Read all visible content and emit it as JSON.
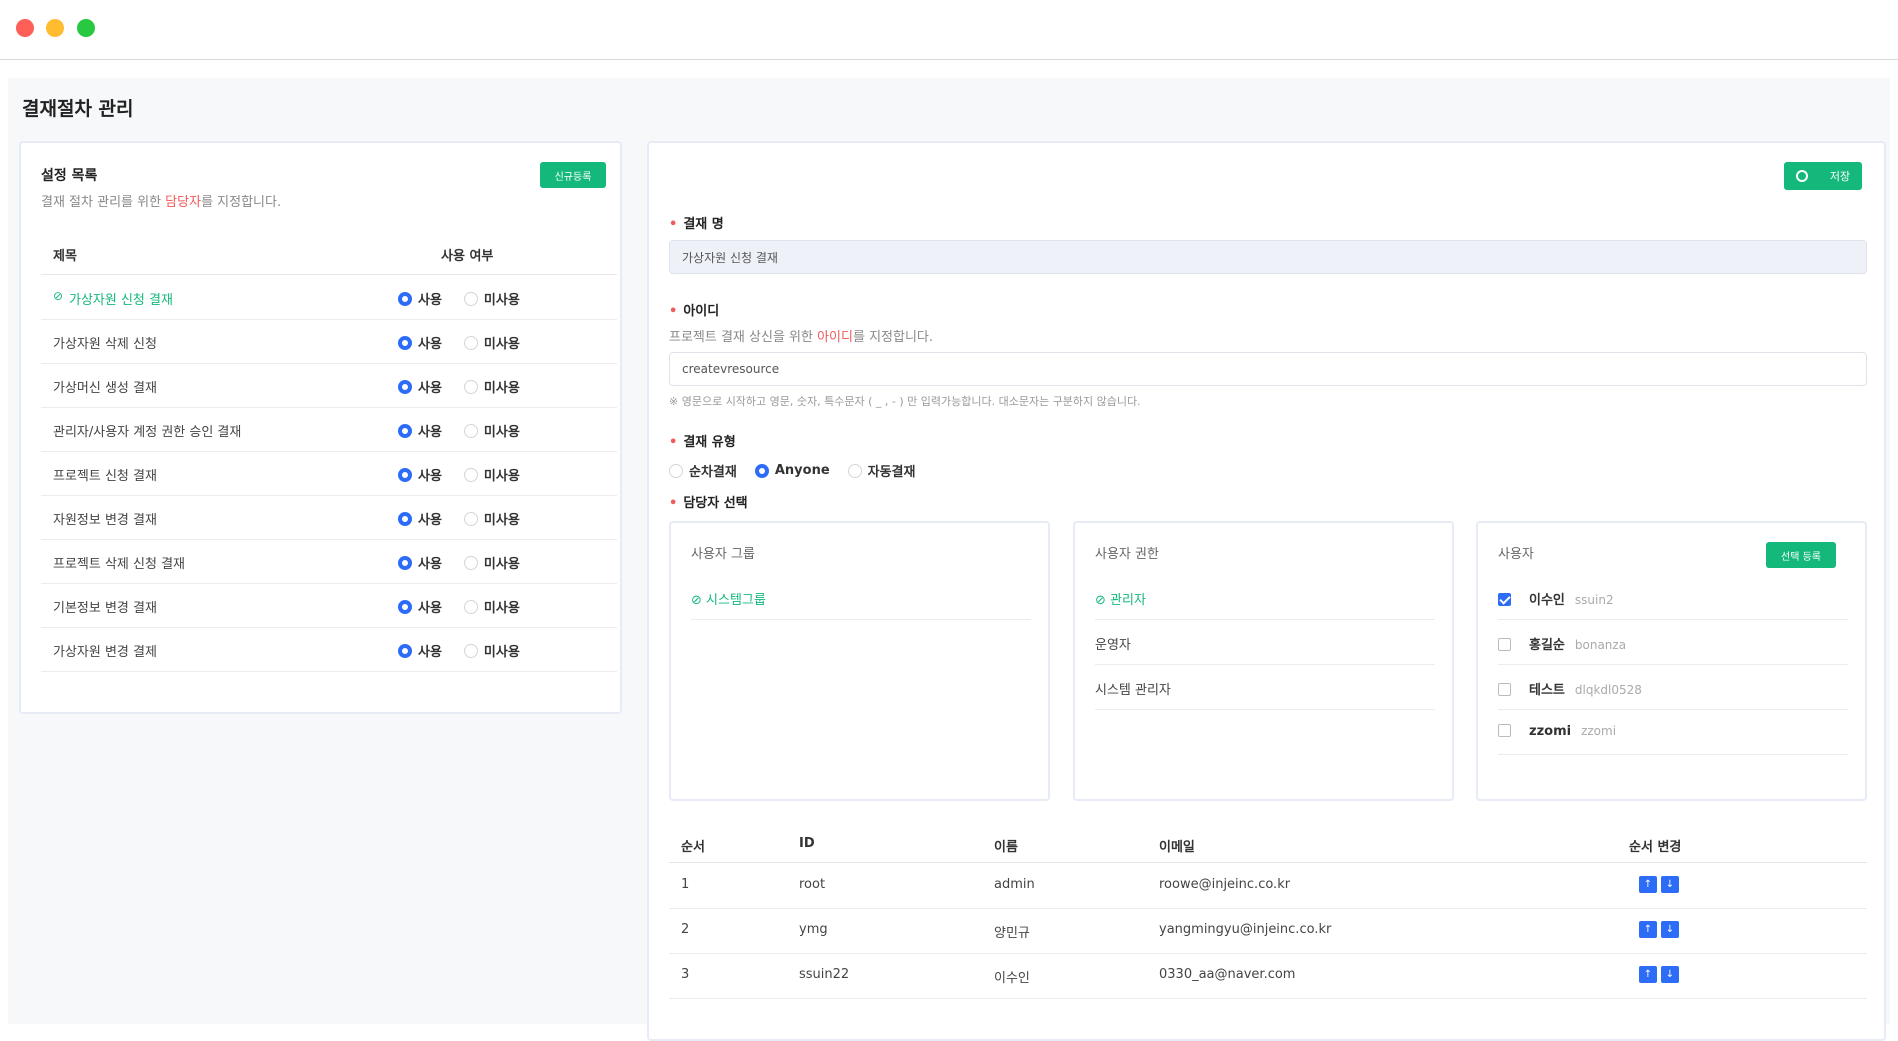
{
  "page": {
    "title": "결재절차 관리"
  },
  "colors": {
    "accent": "#14b87b",
    "primary": "#2c6cf6",
    "highlight": "#ef5b5b"
  },
  "left_panel": {
    "title": "설정 목록",
    "desc_before": "결재 절차 관리를 위한 ",
    "desc_highlight": "담당자",
    "desc_after": "를 지정합니다.",
    "new_button": "신규등록",
    "col_title": "제목",
    "col_use": "사용 여부",
    "use_label": "사용",
    "unuse_label": "미사용",
    "items": [
      {
        "title": "가상자원 신청 결재",
        "active": true,
        "use": true
      },
      {
        "title": "가상자원 삭제 신청",
        "active": false,
        "use": true
      },
      {
        "title": "가상머신 생성 결재",
        "active": false,
        "use": true
      },
      {
        "title": "관리자/사용자 계정 권한 승인 결재",
        "active": false,
        "use": true
      },
      {
        "title": "프로젝트 신청 결재",
        "active": false,
        "use": true
      },
      {
        "title": "자원정보 변경 결재",
        "active": false,
        "use": true
      },
      {
        "title": "프로젝트 삭제 신청 결재",
        "active": false,
        "use": true
      },
      {
        "title": "기본정보 변경 결재",
        "active": false,
        "use": true
      },
      {
        "title": "가상자원 변경 결제",
        "active": false,
        "use": true
      }
    ]
  },
  "form": {
    "save_button": "저장",
    "name_label": "결재 명",
    "name_value": "가상자원 신청 결재",
    "id_label": "아이디",
    "id_help_before": "프로젝트 결재 상신을 위한 ",
    "id_help_highlight": "아이디",
    "id_help_after": "를 지정합니다.",
    "id_value": "createvresource",
    "id_note": "※ 영문으로 시작하고 영문, 숫자, 특수문자 ( _ , - ) 만 입력가능합니다. 대소문자는 구분하지 않습니다.",
    "type_label": "결재 유형",
    "type_options": [
      "순차결재",
      "Anyone",
      "자동결재"
    ],
    "type_selected": "Anyone",
    "assignee_label": "담당자 선택"
  },
  "user_group": {
    "title": "사용자 그룹",
    "items": [
      "시스템그룹"
    ]
  },
  "user_role": {
    "title": "사용자 권한",
    "items": [
      "관리자",
      "운영자",
      "시스템 관리자"
    ]
  },
  "users": {
    "title": "사용자",
    "select_button": "선택 등록",
    "items": [
      {
        "name": "이수인",
        "id": "ssuin2",
        "checked": true
      },
      {
        "name": "홍길순",
        "id": "bonanza",
        "checked": false
      },
      {
        "name": "테스트",
        "id": "dlqkdl0528",
        "checked": false
      },
      {
        "name": "zzomi",
        "id": "zzomi",
        "checked": false
      }
    ]
  },
  "table": {
    "headers": [
      "순서",
      "ID",
      "이름",
      "이메일",
      "순서 변경"
    ],
    "rows": [
      {
        "order": "1",
        "id": "root",
        "name": "admin",
        "email": "roowe@injeinc.co.kr"
      },
      {
        "order": "2",
        "id": "ymg",
        "name": "양민규",
        "email": "yangmingyu@injeinc.co.kr"
      },
      {
        "order": "3",
        "id": "ssuin22",
        "name": "이수인",
        "email": "0330_aa@naver.com"
      }
    ]
  }
}
